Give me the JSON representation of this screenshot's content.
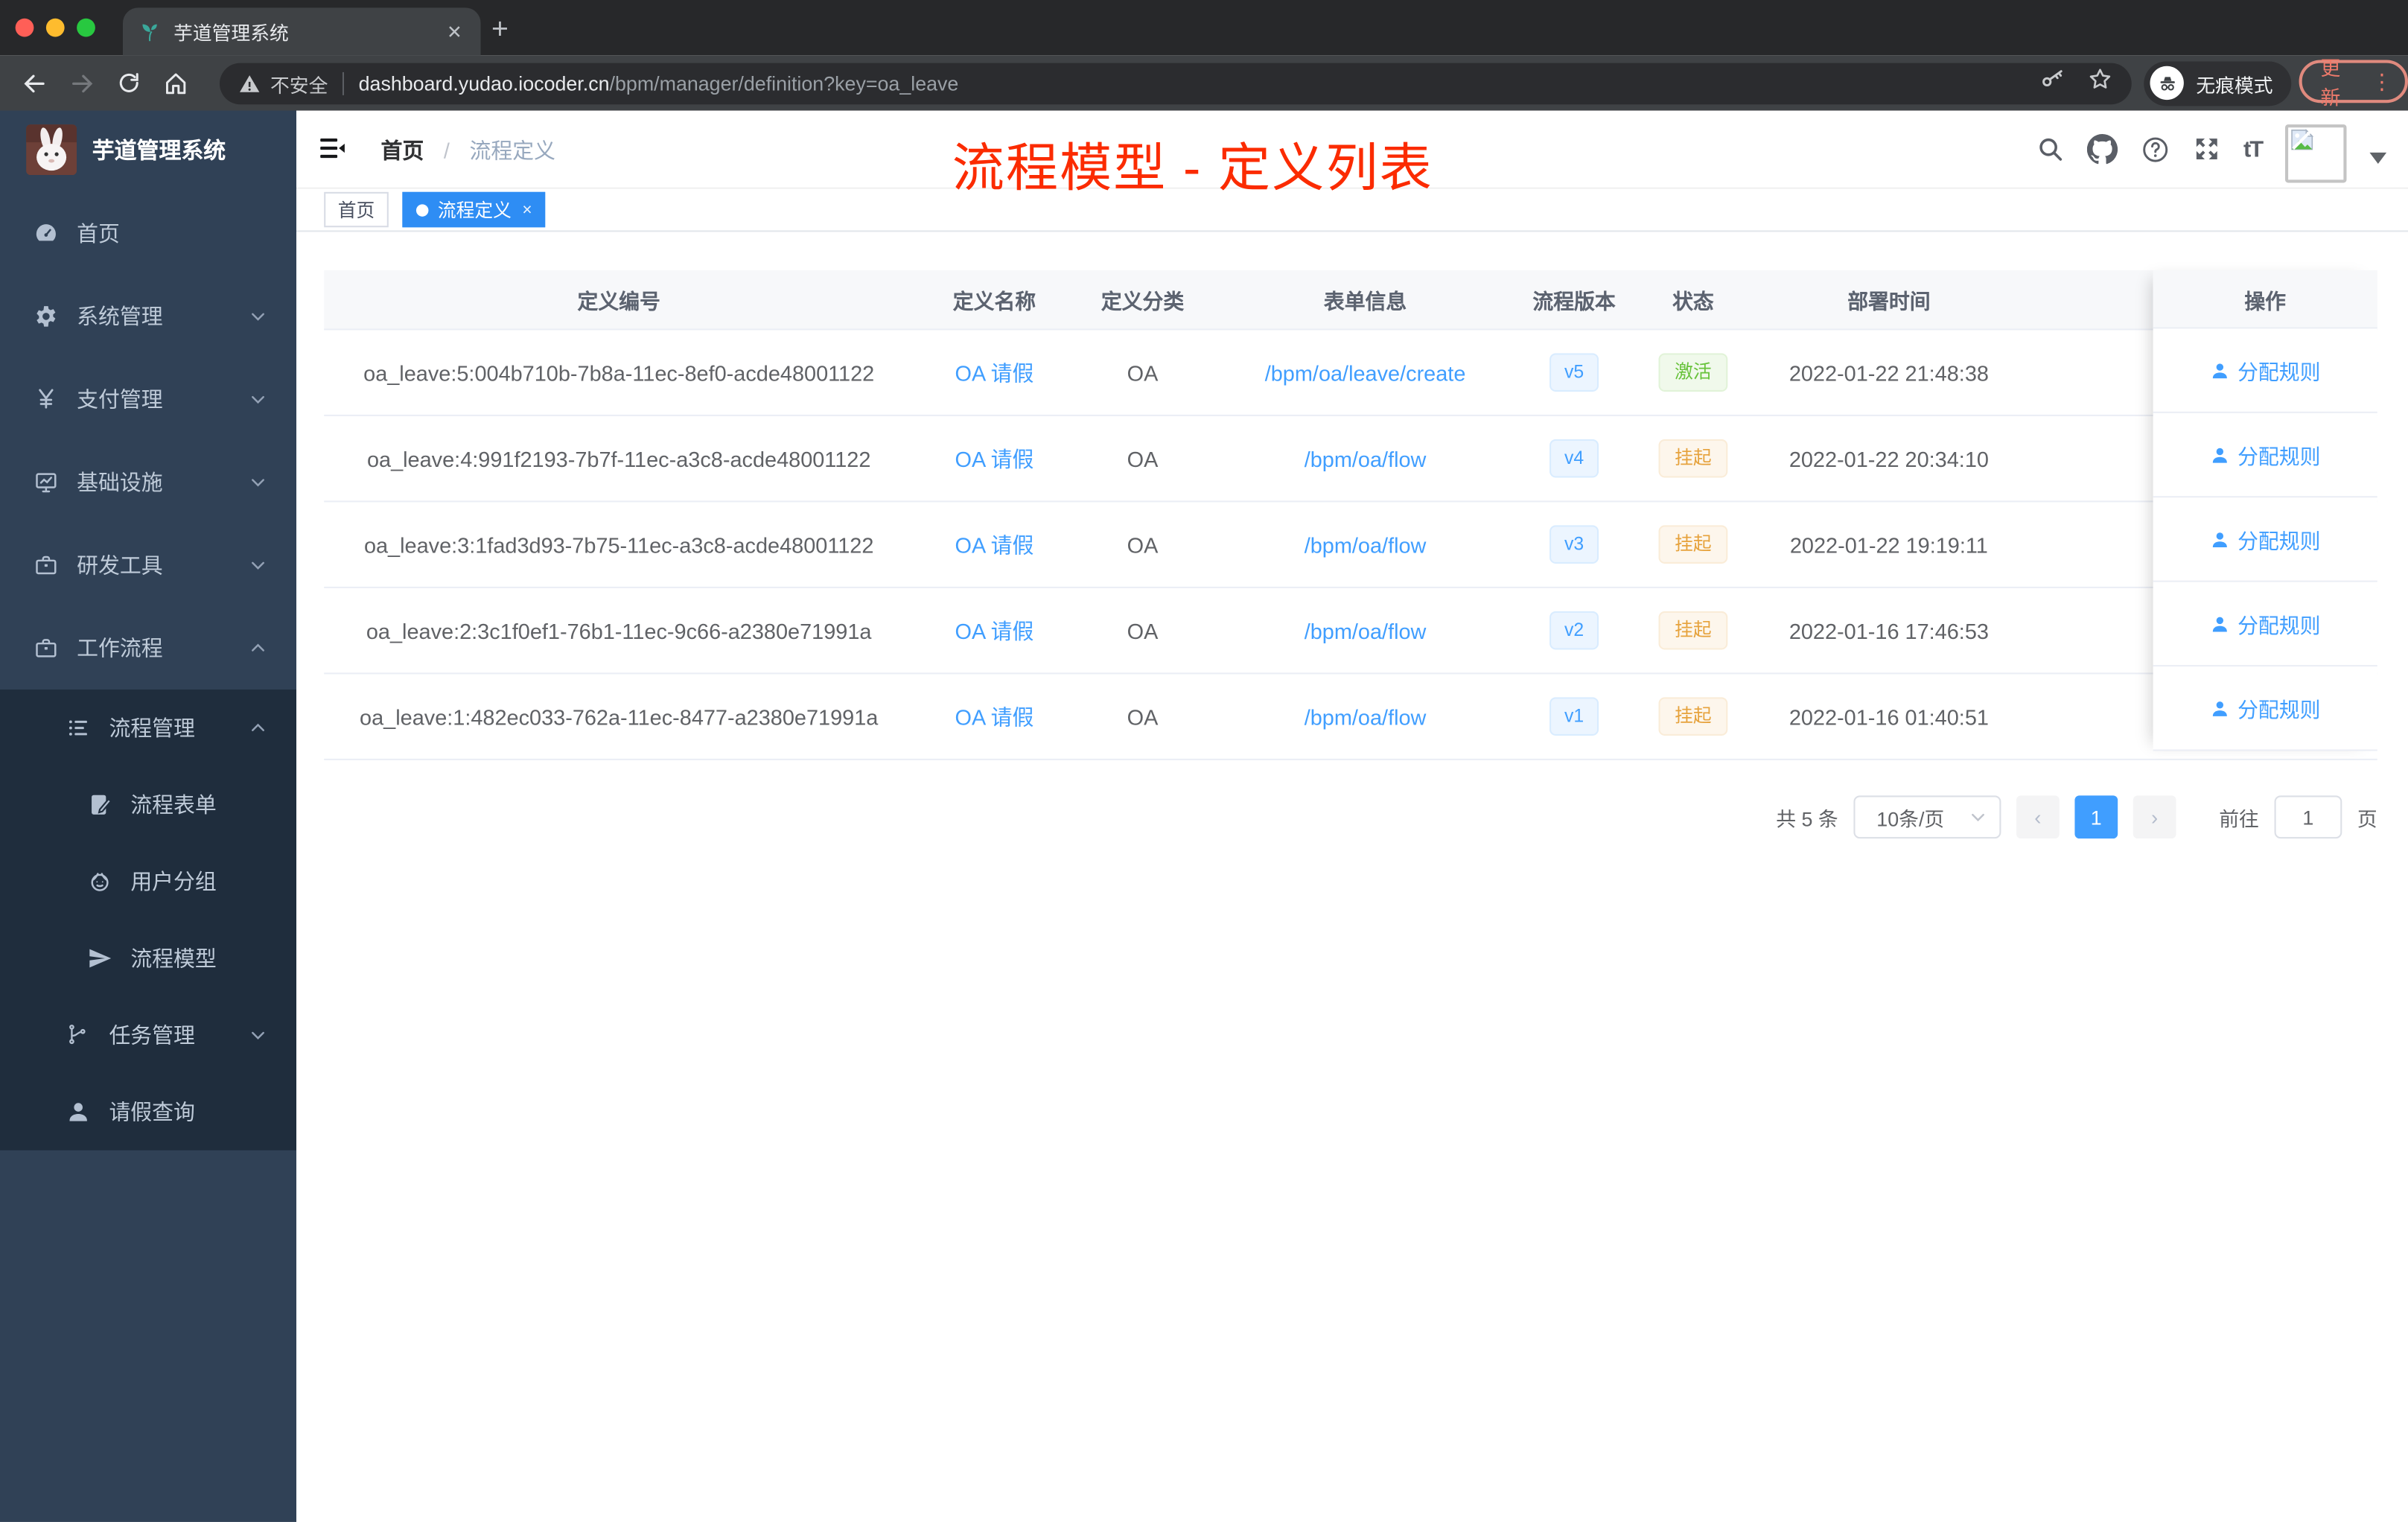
{
  "browser": {
    "tab_title": "芋道管理系统",
    "close_glyph": "✕",
    "newtab_glyph": "+",
    "security_label": "不安全",
    "url_host": "dashboard.yudao.iocoder.cn",
    "url_path": "/bpm/manager/definition?key=oa_leave",
    "incognito_label": "无痕模式",
    "update_label": "更新",
    "menu_dots_glyph": "⋮"
  },
  "sidebar": {
    "logo_title": "芋道管理系统",
    "items": [
      {
        "name": "home",
        "label": "首页",
        "icon": "dashboard-icon",
        "level": 1,
        "chevron": null,
        "submenu": false
      },
      {
        "name": "system",
        "label": "系统管理",
        "icon": "gear-icon",
        "level": 1,
        "chevron": "down",
        "submenu": false
      },
      {
        "name": "payment",
        "label": "支付管理",
        "icon": "yen-icon",
        "level": 1,
        "chevron": "down",
        "submenu": false
      },
      {
        "name": "infrastructure",
        "label": "基础设施",
        "icon": "monitor-icon",
        "level": 1,
        "chevron": "down",
        "submenu": false
      },
      {
        "name": "dev-tools",
        "label": "研发工具",
        "icon": "briefcase-icon",
        "level": 1,
        "chevron": "down",
        "submenu": false
      },
      {
        "name": "workflow",
        "label": "工作流程",
        "icon": "briefcase-icon",
        "level": 1,
        "chevron": "up",
        "submenu": false
      },
      {
        "name": "process-management",
        "label": "流程管理",
        "icon": "list-icon",
        "level": 2,
        "chevron": "up",
        "submenu": true
      },
      {
        "name": "process-form",
        "label": "流程表单",
        "icon": "form-icon",
        "level": 3,
        "chevron": null,
        "submenu": true
      },
      {
        "name": "user-group",
        "label": "用户分组",
        "icon": "user-group-icon",
        "level": 3,
        "chevron": null,
        "submenu": true
      },
      {
        "name": "process-model",
        "label": "流程模型",
        "icon": "paper-plane-icon",
        "level": 3,
        "chevron": null,
        "submenu": true
      },
      {
        "name": "task-management",
        "label": "任务管理",
        "icon": "tree-icon",
        "level": 2,
        "chevron": "down",
        "submenu": true
      },
      {
        "name": "leave-query",
        "label": "请假查询",
        "icon": "person-icon",
        "level": 2,
        "chevron": null,
        "submenu": true
      }
    ]
  },
  "navbar": {
    "breadcrumb_home": "首页",
    "breadcrumb_sep": "/",
    "breadcrumb_current": "流程定义",
    "font_size_label": "tT"
  },
  "annotation": {
    "text": "流程模型 - 定义列表",
    "color": "#fb2b00"
  },
  "tags": [
    {
      "label": "首页",
      "active": false,
      "closable": false
    },
    {
      "label": "流程定义",
      "active": true,
      "closable": true
    }
  ],
  "table": {
    "columns": [
      "定义编号",
      "定义名称",
      "定义分类",
      "表单信息",
      "流程版本",
      "状态",
      "部署时间",
      "操作"
    ],
    "rows": [
      {
        "id": "oa_leave:5:004b710b-7b8a-11ec-8ef0-acde48001122",
        "name": "OA 请假",
        "category": "OA",
        "form": "/bpm/oa/leave/create",
        "version": "v5",
        "status": "激活",
        "status_type": "success",
        "deployed": "2022-01-22 21:48:38",
        "action": "分配规则"
      },
      {
        "id": "oa_leave:4:991f2193-7b7f-11ec-a3c8-acde48001122",
        "name": "OA 请假",
        "category": "OA",
        "form": "/bpm/oa/flow",
        "version": "v4",
        "status": "挂起",
        "status_type": "warning",
        "deployed": "2022-01-22 20:34:10",
        "action": "分配规则"
      },
      {
        "id": "oa_leave:3:1fad3d93-7b75-11ec-a3c8-acde48001122",
        "name": "OA 请假",
        "category": "OA",
        "form": "/bpm/oa/flow",
        "version": "v3",
        "status": "挂起",
        "status_type": "warning",
        "deployed": "2022-01-22 19:19:11",
        "action": "分配规则"
      },
      {
        "id": "oa_leave:2:3c1f0ef1-76b1-11ec-9c66-a2380e71991a",
        "name": "OA 请假",
        "category": "OA",
        "form": "/bpm/oa/flow",
        "version": "v2",
        "status": "挂起",
        "status_type": "warning",
        "deployed": "2022-01-16 17:46:53",
        "action": "分配规则"
      },
      {
        "id": "oa_leave:1:482ec033-762a-11ec-8477-a2380e71991a",
        "name": "OA 请假",
        "category": "OA",
        "form": "/bpm/oa/flow",
        "version": "v1",
        "status": "挂起",
        "status_type": "warning",
        "deployed": "2022-01-16 01:40:51",
        "action": "分配规则"
      }
    ]
  },
  "pagination": {
    "total_label": "共 5 条",
    "page_size": "10条/页",
    "prev_glyph": "‹",
    "next_glyph": "›",
    "current_page": "1",
    "goto_label": "前往",
    "goto_value": "1",
    "page_unit": "页"
  },
  "colors": {
    "accent_blue": "#409eff",
    "tag_active_blue": "#2e8df4",
    "sidebar_bg": "#304156",
    "submenu_bg": "#1f2d3d",
    "success_green": "#67c23a",
    "warning_orange": "#e6a23c",
    "annotation_red": "#fb2b00"
  }
}
